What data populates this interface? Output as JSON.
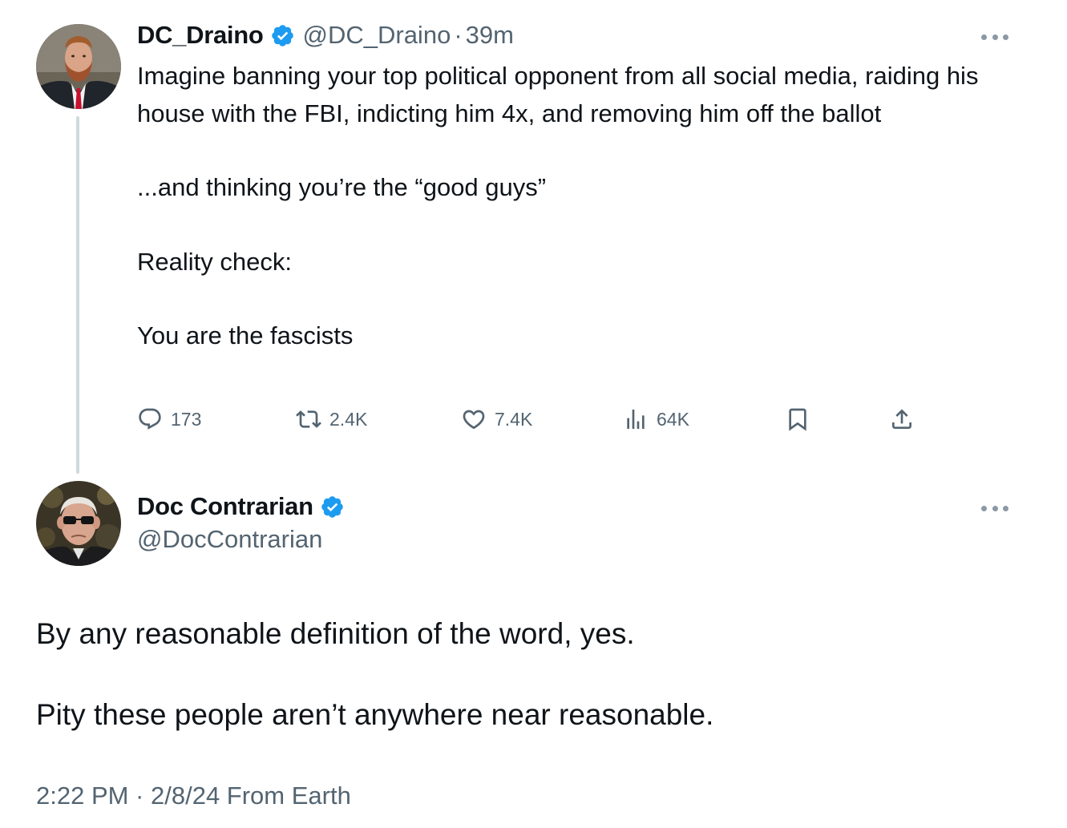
{
  "original_tweet": {
    "display_name": "DC_Draino",
    "handle": "@DC_Draino",
    "separator": "·",
    "time": "39m",
    "text_lines": [
      "Imagine banning your top political opponent from all social media, raiding his house with the FBI, indicting him 4x, and removing him off the ballot",
      "...and thinking you’re the “good guys”",
      "Reality check:",
      "You are the fascists"
    ],
    "stats": {
      "replies": "173",
      "reposts": "2.4K",
      "likes": "7.4K",
      "views": "64K"
    },
    "icons": {
      "reply": "reply-icon",
      "repost": "repost-icon",
      "like": "heart-icon",
      "views": "views-chart-icon",
      "bookmark": "bookmark-icon",
      "share": "share-icon",
      "verified": "verified-badge-icon",
      "more": "more-options-icon"
    }
  },
  "reply_tweet": {
    "display_name": "Doc Contrarian",
    "handle": "@DocContrarian",
    "text_lines": [
      "By any reasonable definition of the word, yes.",
      "Pity these people aren’t anywhere near reasonable."
    ],
    "timestamp": "2:22 PM · 2/8/24 From Earth"
  },
  "colors": {
    "text": "#0f1419",
    "secondary": "#536471",
    "verified": "#1d9bf0",
    "thread_line": "#cfd9de"
  }
}
